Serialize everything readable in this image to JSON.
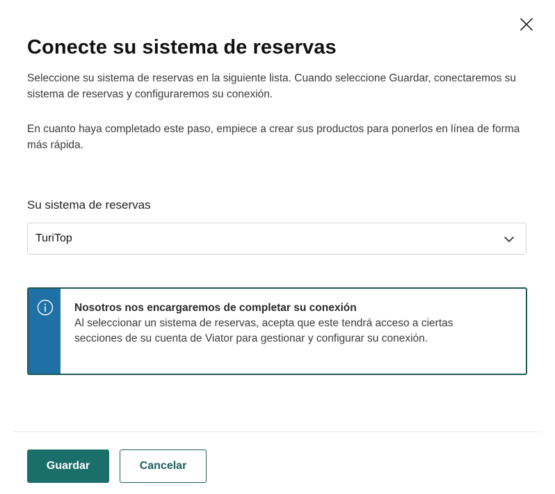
{
  "dialog": {
    "title": "Conecte su sistema de reservas",
    "description_1": "Seleccione su sistema de reservas en la siguiente lista. Cuando seleccione Guardar, conectaremos su sistema de reservas y configuraremos su conexión.",
    "description_2": "En cuanto haya completado este paso, empiece a crear sus productos para ponerlos en línea de forma más rápida.",
    "close_icon": "close-icon"
  },
  "booking_system": {
    "label": "Su sistema de reservas",
    "selected_value": "TuriTop",
    "chevron_icon": "chevron-down-icon"
  },
  "notice": {
    "icon": "info-icon",
    "title": "Nosotros nos encargaremos de completar su conexión",
    "body": "Al seleccionar un sistema de reservas, acepta que este tendrá acceso a ciertas secciones de su cuenta de Viator para gestionar y configurar su conexión.",
    "stripe_color": "#1f70a4",
    "border_color": "#1d5a55"
  },
  "footer": {
    "save_label": "Guardar",
    "cancel_label": "Cancelar",
    "primary_color": "#1b6f6b"
  }
}
